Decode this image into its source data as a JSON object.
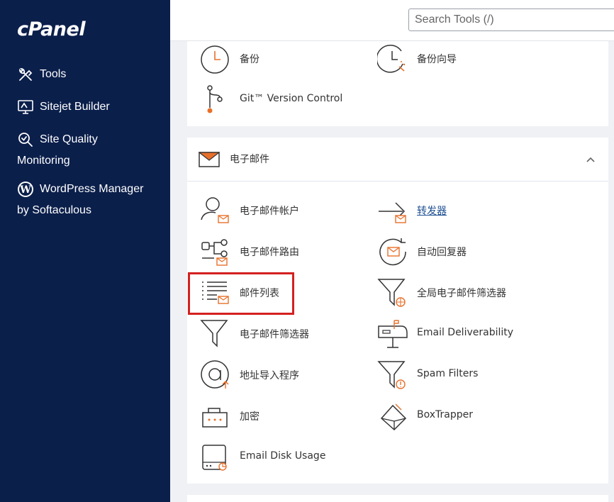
{
  "app": {
    "logo": "cPanel"
  },
  "search": {
    "placeholder": "Search Tools (/)"
  },
  "sidebar": {
    "items": [
      {
        "label": "Tools",
        "icon": "tools-icon"
      },
      {
        "label": "Sitejet Builder",
        "icon": "monitor-icon"
      },
      {
        "label": "Site Quality",
        "label2": "Monitoring",
        "icon": "magnifier-icon"
      },
      {
        "label": "WordPress Manager",
        "label2": "by Softaculous",
        "icon": "wordpress-icon"
      }
    ]
  },
  "files_section": {
    "tools": [
      {
        "label": "备份",
        "icon": "backup-clock-icon"
      },
      {
        "label": "备份向导",
        "icon": "backup-wizard-icon"
      },
      {
        "label": "Git™ Version Control",
        "icon": "git-branch-icon"
      }
    ]
  },
  "email_section": {
    "title": "电子邮件",
    "icon": "envelope-icon",
    "tools": [
      {
        "label": "电子邮件帐户",
        "icon": "email-account-icon"
      },
      {
        "label": "转发器",
        "icon": "forwarder-arrow-icon"
      },
      {
        "label": "电子邮件路由",
        "icon": "email-routing-icon"
      },
      {
        "label": "自动回复器",
        "icon": "autoresponder-icon"
      },
      {
        "label": "邮件列表",
        "icon": "mailing-list-icon"
      },
      {
        "label": "全局电子邮件筛选器",
        "icon": "global-filter-icon"
      },
      {
        "label": "电子邮件筛选器",
        "icon": "email-filter-icon"
      },
      {
        "label": "Email Deliverability",
        "icon": "mailbox-icon"
      },
      {
        "label": "地址导入程序",
        "icon": "address-importer-icon"
      },
      {
        "label": "Spam Filters",
        "icon": "spam-filter-icon"
      },
      {
        "label": "加密",
        "icon": "encryption-icon"
      },
      {
        "label": "BoxTrapper",
        "icon": "boxtrapper-icon"
      },
      {
        "label": "Email Disk Usage",
        "icon": "disk-usage-icon"
      }
    ]
  },
  "colors": {
    "sidebar_bg": "#0b1f4b",
    "accent_orange": "#e8702a",
    "highlight_red": "#d42020"
  }
}
